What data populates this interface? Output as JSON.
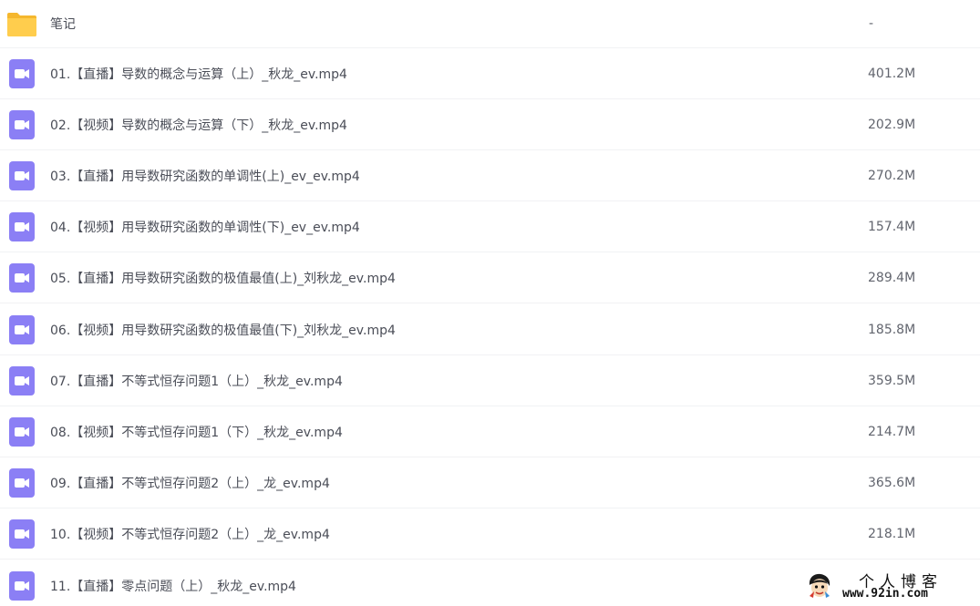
{
  "rows": [
    {
      "type": "folder",
      "name": "笔记",
      "size": "-"
    },
    {
      "type": "video",
      "name": "01.【直播】导数的概念与运算（上）_秋龙_ev.mp4",
      "size": "401.2M"
    },
    {
      "type": "video",
      "name": "02.【视频】导数的概念与运算（下）_秋龙_ev.mp4",
      "size": "202.9M"
    },
    {
      "type": "video",
      "name": "03.【直播】用导数研究函数的单调性(上)_ev_ev.mp4",
      "size": "270.2M"
    },
    {
      "type": "video",
      "name": "04.【视频】用导数研究函数的单调性(下)_ev_ev.mp4",
      "size": "157.4M"
    },
    {
      "type": "video",
      "name": "05.【直播】用导数研究函数的极值最值(上)_刘秋龙_ev.mp4",
      "size": "289.4M"
    },
    {
      "type": "video",
      "name": "06.【视频】用导数研究函数的极值最值(下)_刘秋龙_ev.mp4",
      "size": "185.8M"
    },
    {
      "type": "video",
      "name": "07.【直播】不等式恒存问题1（上）_秋龙_ev.mp4",
      "size": "359.5M"
    },
    {
      "type": "video",
      "name": "08.【视频】不等式恒存问题1（下）_秋龙_ev.mp4",
      "size": "214.7M"
    },
    {
      "type": "video",
      "name": "09.【直播】不等式恒存问题2（上）_龙_ev.mp4",
      "size": "365.6M"
    },
    {
      "type": "video",
      "name": "10.【视频】不等式恒存问题2（上）_龙_ev.mp4",
      "size": "218.1M"
    },
    {
      "type": "video",
      "name": "11.【直播】零点问题（上）_秋龙_ev.mp4",
      "size": ""
    }
  ],
  "watermark": {
    "title": "个人博客",
    "url": "www.92in.com"
  },
  "colors": {
    "folder": "#ffcd4d",
    "folder_dark": "#f5b72e",
    "video": "#8b7ff5"
  }
}
